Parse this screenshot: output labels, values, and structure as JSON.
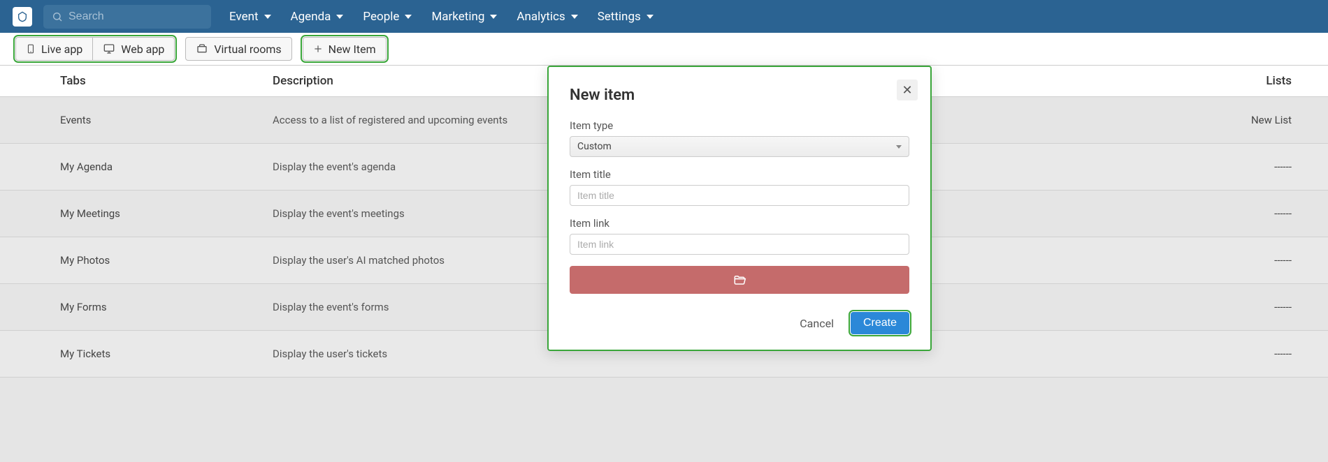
{
  "topbar": {
    "search_placeholder": "Search",
    "menu": [
      "Event",
      "Agenda",
      "People",
      "Marketing",
      "Analytics",
      "Settings"
    ]
  },
  "toolbar": {
    "live_app": "Live app",
    "web_app": "Web app",
    "virtual_rooms": "Virtual rooms",
    "new_item": "New Item"
  },
  "table": {
    "headers": {
      "tabs": "Tabs",
      "description": "Description",
      "lists": "Lists"
    },
    "rows": [
      {
        "tab": "Events",
        "desc": "Access to a list of registered and upcoming events",
        "lists": "New List"
      },
      {
        "tab": "My Agenda",
        "desc": "Display the event's agenda",
        "lists": "------"
      },
      {
        "tab": "My Meetings",
        "desc": "Display the event's meetings",
        "lists": "------"
      },
      {
        "tab": "My Photos",
        "desc": "Display the user's AI matched photos",
        "lists": "------"
      },
      {
        "tab": "My Forms",
        "desc": "Display the event's forms",
        "lists": "------"
      },
      {
        "tab": "My Tickets",
        "desc": "Display the user's tickets",
        "lists": "------"
      }
    ]
  },
  "modal": {
    "title": "New item",
    "item_type_label": "Item type",
    "item_type_value": "Custom",
    "item_title_label": "Item title",
    "item_title_placeholder": "Item title",
    "item_link_label": "Item link",
    "item_link_placeholder": "Item link",
    "cancel": "Cancel",
    "create": "Create"
  }
}
